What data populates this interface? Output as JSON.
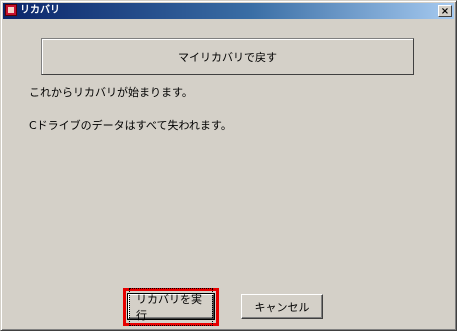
{
  "window": {
    "title": "リカバリ",
    "close_label": "×"
  },
  "main": {
    "panel_button_label": "マイリカバリで戻す",
    "message_1": "これからリカバリが始まります。",
    "message_2": "Cドライブのデータはすべて失われます。"
  },
  "actions": {
    "run_label": "リカバリを実行",
    "cancel_label": "キャンセル"
  },
  "colors": {
    "highlight": "#e60000",
    "titlebar_start": "#0a246a",
    "titlebar_end": "#a6caf0",
    "face": "#d4d0c8"
  }
}
